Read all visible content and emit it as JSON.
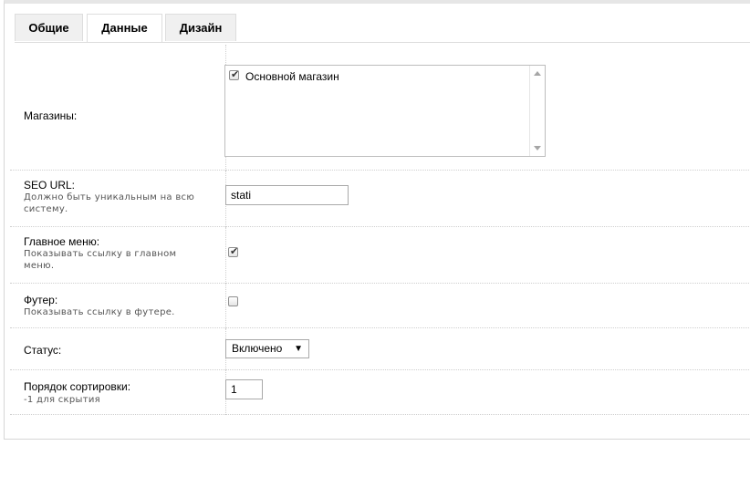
{
  "tabs": [
    "Общие",
    "Данные",
    "Дизайн"
  ],
  "active_tab": "Данные",
  "stores": {
    "label": "Магазины:",
    "items": [
      {
        "label": "Основной магазин",
        "checked": true
      }
    ]
  },
  "seo": {
    "label": "SEO URL:",
    "help": "Должно быть уникальным на всю систему.",
    "value": "stati"
  },
  "main_menu": {
    "label": "Главное меню:",
    "help": "Показывать ссылку в главном меню.",
    "checked": true
  },
  "footer": {
    "label": "Футер:",
    "help": "Показывать ссылку в футере.",
    "checked": false
  },
  "status": {
    "label": "Статус:",
    "value": "Включено"
  },
  "sort": {
    "label": "Порядок сортировки:",
    "help": "-1 для скрытия",
    "value": "1"
  }
}
